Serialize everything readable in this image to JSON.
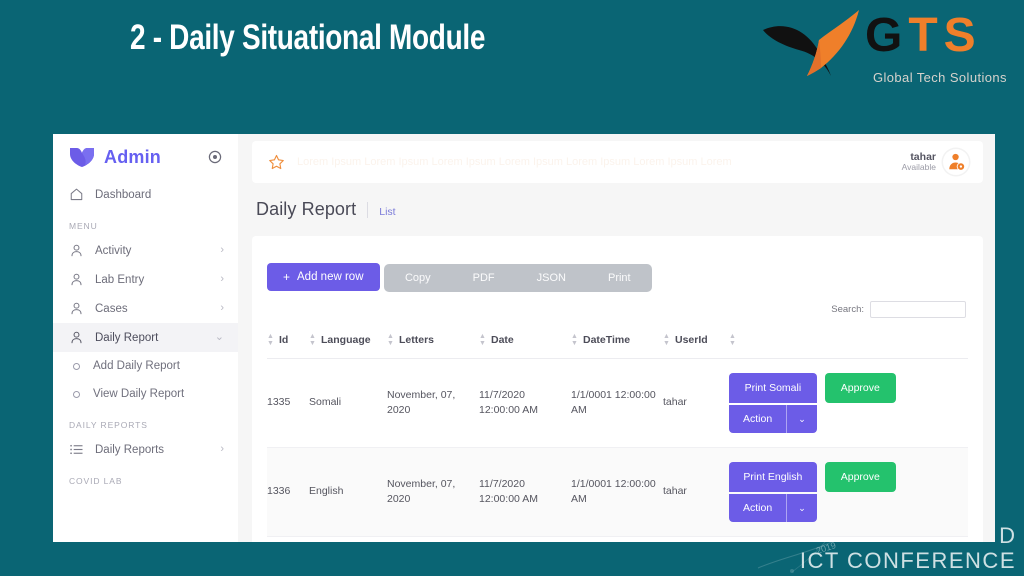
{
  "slide": {
    "title": "2 - Daily Situational Module",
    "background_color": "#0a6574",
    "logo": {
      "g": "G",
      "t": "T",
      "s": "S",
      "tagline": "Global Tech Solutions",
      "accent_color": "#ef7f2a",
      "dark_color": "#111111"
    },
    "watermark": {
      "top": "D",
      "main": "ICT CONFERENCE",
      "year": "2019"
    }
  },
  "sidebar": {
    "brand": "Admin",
    "brand_color": "#6660f1",
    "dashboard": {
      "label": "Dashboard",
      "icon": "home-icon"
    },
    "menu_heading": "MENU",
    "menu_items": [
      {
        "label": "Activity",
        "icon": "person-icon",
        "arrow": "›",
        "active": false
      },
      {
        "label": "Lab Entry",
        "icon": "person-icon",
        "arrow": "›",
        "active": false
      },
      {
        "label": "Cases",
        "icon": "person-icon",
        "arrow": "›",
        "active": false
      },
      {
        "label": "Daily Report",
        "icon": "person-icon",
        "arrow": "⌄",
        "active": true
      }
    ],
    "sub_items": [
      {
        "label": "Add Daily Report"
      },
      {
        "label": "View Daily Report"
      }
    ],
    "reports_heading": "DAILY REPORTS",
    "reports_items": [
      {
        "label": "Daily Reports",
        "icon": "list-icon",
        "arrow": "›"
      }
    ],
    "covid_heading": "COVID LAB"
  },
  "topbar": {
    "star_icon": "star-icon",
    "ghost_text": "Lorem Ipsum Lorem Ipsum Lorem Ipsum Lorem Ipsum Lorem Ipsum Lorem Ipsum Lorem",
    "user_name": "tahar",
    "user_status": "Available",
    "avatar_icon": "user-settings-icon",
    "avatar_color": "#ef7f2a"
  },
  "page": {
    "title": "Daily Report",
    "breadcrumb": "List"
  },
  "toolbar": {
    "add_row_label": "Add new row",
    "add_row_plus": "+",
    "add_row_color": "#6c5ce7",
    "export_buttons": [
      "Copy",
      "PDF",
      "JSON",
      "Print"
    ]
  },
  "search": {
    "label": "Search:",
    "value": "",
    "placeholder": ""
  },
  "table": {
    "columns": [
      "Id",
      "Language",
      "Letters",
      "Date",
      "DateTime",
      "UserId",
      ""
    ],
    "rows": [
      {
        "id": "1335",
        "language": "Somali",
        "letters": "November, 07, 2020",
        "date": "11/7/2020 12:00:00 AM",
        "datetime": "1/1/0001 12:00:00 AM",
        "userid": "tahar",
        "print_label": "Print Somali",
        "action_label": "Action",
        "action_caret": "⌄",
        "approve_label": "Approve"
      },
      {
        "id": "1336",
        "language": "English",
        "letters": "November, 07, 2020",
        "date": "11/7/2020 12:00:00 AM",
        "datetime": "1/1/0001 12:00:00 AM",
        "userid": "tahar",
        "print_label": "Print English",
        "action_label": "Action",
        "action_caret": "⌄",
        "approve_label": "Approve"
      }
    ]
  },
  "colors": {
    "primary": "#6c5ce7",
    "success": "#24c26d",
    "slide_bg": "#0a6574",
    "export_bar": "#bfc3c9"
  }
}
